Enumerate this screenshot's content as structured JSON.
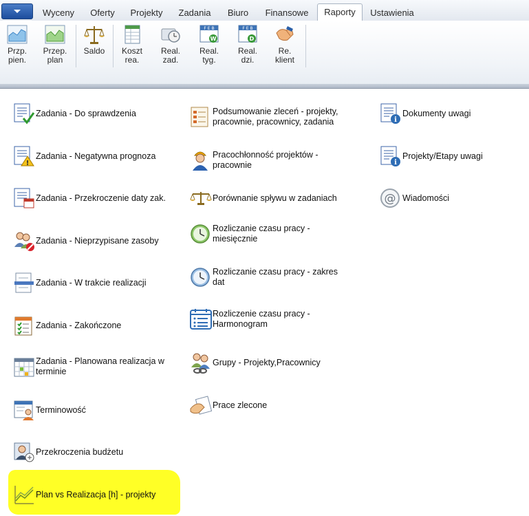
{
  "tabs": [
    {
      "label": "Wyceny",
      "active": false
    },
    {
      "label": "Oferty",
      "active": false
    },
    {
      "label": "Projekty",
      "active": false
    },
    {
      "label": "Zadania",
      "active": false
    },
    {
      "label": "Biuro",
      "active": false
    },
    {
      "label": "Finansowe",
      "active": false
    },
    {
      "label": "Raporty",
      "active": true
    },
    {
      "label": "Ustawienia",
      "active": false
    }
  ],
  "ribbon": {
    "buttons": [
      {
        "line1": "Przp.",
        "line2": "pien.",
        "icon": "chart-area-icon"
      },
      {
        "line1": "Przep.",
        "line2": "plan",
        "icon": "chart-area-green-icon"
      },
      {
        "line1": "Saldo",
        "line2": "",
        "icon": "scales-icon"
      },
      {
        "line1": "Koszt",
        "line2": "rea.",
        "icon": "spreadsheet-icon"
      },
      {
        "line1": "Real.",
        "line2": "zad.",
        "icon": "clock-card-icon"
      },
      {
        "line1": "Real.",
        "line2": "tyg.",
        "icon": "calendar-week-icon"
      },
      {
        "line1": "Real.",
        "line2": "dzi.",
        "icon": "calendar-day-icon"
      },
      {
        "line1": "Re.",
        "line2": "klient",
        "icon": "handshake-icon"
      }
    ]
  },
  "reports": {
    "col1": [
      {
        "label": "Zadania - Do sprawdzenia",
        "icon": "checklist-ok-icon"
      },
      {
        "label": "Zadania - Negatywna prognoza",
        "icon": "checklist-warning-icon"
      },
      {
        "label": "Zadania - Przekroczenie  daty zak.",
        "icon": "checklist-calendar-icon"
      },
      {
        "label": "Zadania - Nieprzypisane zasoby",
        "icon": "users-blocked-icon"
      },
      {
        "label": "Zadania - W trakcie realizacji",
        "icon": "document-progress-icon"
      },
      {
        "label": "Zadania - Zakończone",
        "icon": "calendar-checklist-icon"
      },
      {
        "label": "Zadania - Planowana realizacja w terminie",
        "icon": "calendar-grid-icon"
      },
      {
        "label": "Terminowość",
        "icon": "person-schedule-icon"
      },
      {
        "label": "Przekroczenia budżetu",
        "icon": "person-budget-icon"
      },
      {
        "label": "Plan vs Realizacja [h] - projekty",
        "icon": "line-chart-icon"
      }
    ],
    "col2": [
      {
        "label": "Podsumowanie zleceń - projekty, pracownie, pracownicy, zadania",
        "icon": "document-summary-icon"
      },
      {
        "label": "Pracochłonność projektów - pracownie",
        "icon": "worker-icon"
      },
      {
        "label": "Porównanie spływu w zadaniach",
        "icon": "scales-icon"
      },
      {
        "label": "Rozliczanie czasu pracy - miesięcznie",
        "icon": "clock-green-icon"
      },
      {
        "label": "Rozliczanie czasu pracy - zakres dat",
        "icon": "clock-blue-icon"
      },
      {
        "label": "Rozliczenie czasu pracy - Harmonogram",
        "icon": "schedule-list-icon"
      },
      {
        "label": "Grupy - Projekty,Pracownicy",
        "icon": "group-link-icon"
      },
      {
        "label": "Prace zlecone",
        "icon": "hand-document-icon"
      }
    ],
    "col3": [
      {
        "label": "Dokumenty uwagi",
        "icon": "document-info-icon"
      },
      {
        "label": "Projekty/Etapy uwagi",
        "icon": "document-info-icon"
      },
      {
        "label": "Wiadomości",
        "icon": "at-sign-icon"
      }
    ]
  }
}
